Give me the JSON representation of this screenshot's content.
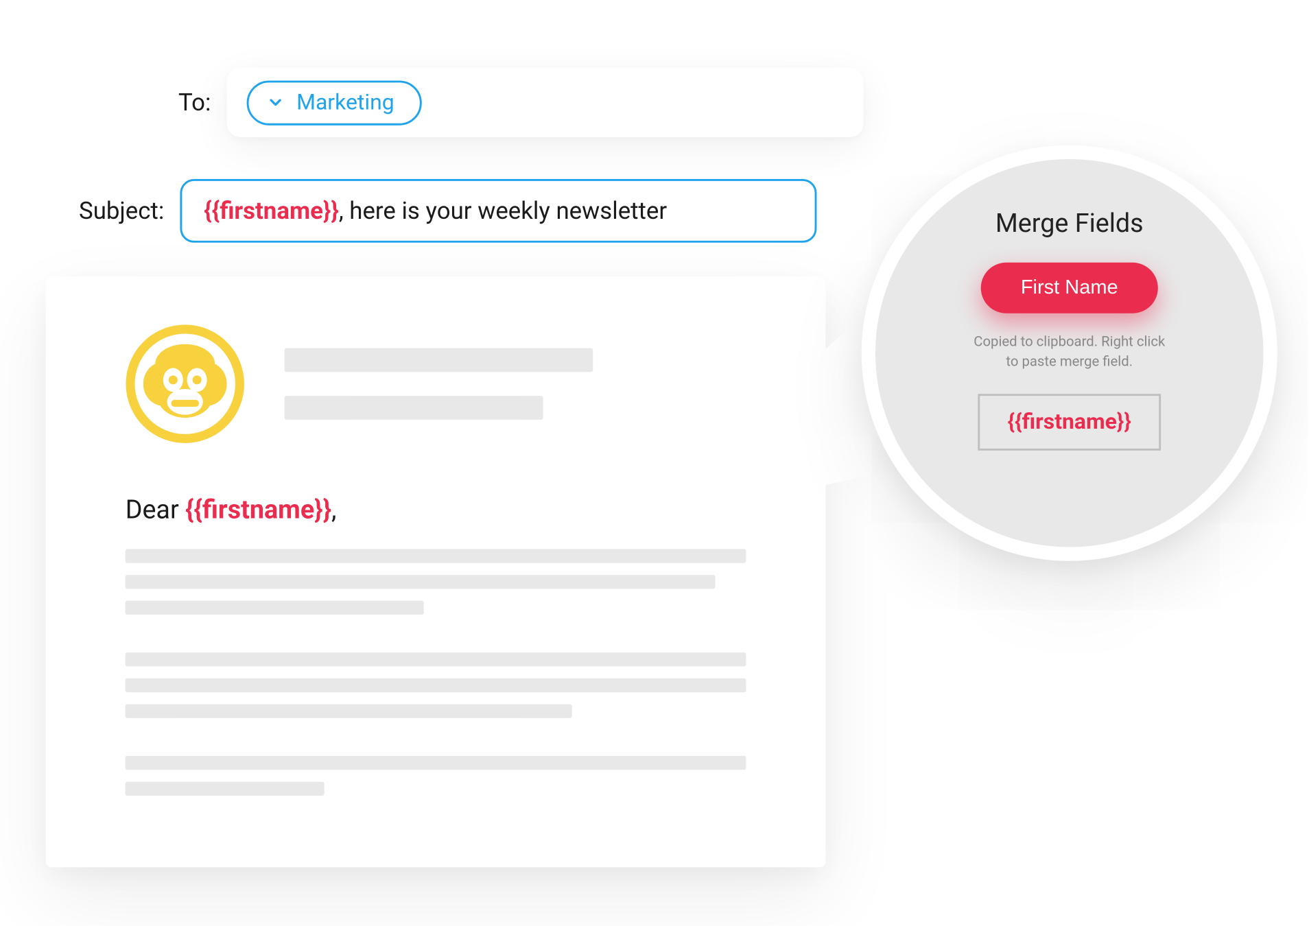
{
  "labels": {
    "to": "To:",
    "subject": "Subject:"
  },
  "to": {
    "chip_label": "Marketing"
  },
  "subject": {
    "merge_token": "{{firstname}}",
    "rest": ", here is your weekly newsletter"
  },
  "body": {
    "greeting_prefix": "Dear ",
    "greeting_token": "{{firstname}}",
    "greeting_suffix": ","
  },
  "callout": {
    "title": "Merge Fields",
    "button_label": "First Name",
    "help_line1": "Copied to clipboard. Right click",
    "help_line2": "to paste merge field.",
    "token": "{{firstname}}"
  },
  "colors": {
    "accent_blue": "#1fa3ed",
    "accent_red": "#ea2d4e",
    "logo_yellow": "#f7d23e",
    "placeholder": "#e8e8e8"
  }
}
